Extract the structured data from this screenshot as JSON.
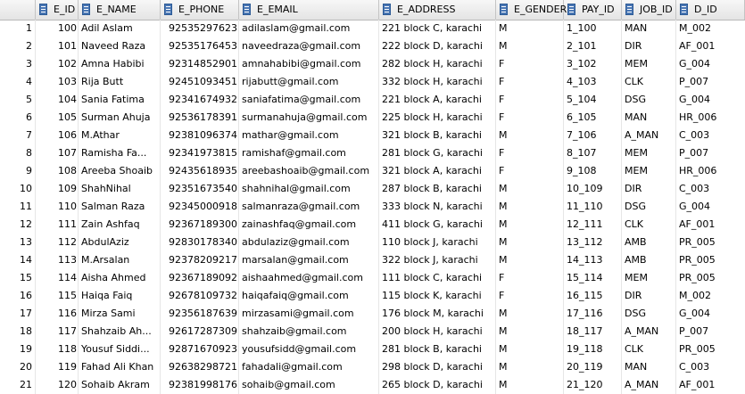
{
  "columns": [
    {
      "key": "rownum",
      "label": ""
    },
    {
      "key": "e_id",
      "label": "E_ID"
    },
    {
      "key": "e_name",
      "label": "E_NAME"
    },
    {
      "key": "e_phone",
      "label": "E_PHONE"
    },
    {
      "key": "e_email",
      "label": "E_EMAIL"
    },
    {
      "key": "e_address",
      "label": "E_ADDRESS"
    },
    {
      "key": "e_gender",
      "label": "E_GENDER"
    },
    {
      "key": "pay_id",
      "label": "PAY_ID"
    },
    {
      "key": "job_id",
      "label": "JOB_ID"
    },
    {
      "key": "d_id",
      "label": "D_ID"
    }
  ],
  "rows": [
    [
      "1",
      "100",
      "Adil Aslam",
      "92535297623",
      "adilaslam@gmail.com",
      "221 block C, karachi",
      "M",
      "1_100",
      "MAN",
      "M_002"
    ],
    [
      "2",
      "101",
      "Naveed Raza",
      "92535176453",
      "naveedraza@gmail.com",
      "222 block D, karachi",
      "M",
      "2_101",
      "DIR",
      "AF_001"
    ],
    [
      "3",
      "102",
      "Amna Habibi",
      "92314852901",
      "amnahabibi@gmail.com",
      "282 block H, karachi",
      "F",
      "3_102",
      "MEM",
      "G_004"
    ],
    [
      "4",
      "103",
      "Rija Butt",
      "92451093451",
      "rijabutt@gmail.com",
      "332 block H, karachi",
      "F",
      "4_103",
      "CLK",
      "P_007"
    ],
    [
      "5",
      "104",
      "Sania Fatima",
      "92341674932",
      "saniafatima@gmail.com",
      "221 block A, karachi",
      "F",
      "5_104",
      "DSG",
      "G_004"
    ],
    [
      "6",
      "105",
      "Surman Ahuja",
      "92536178391",
      "surmanahuja@gmail.com",
      "225 block H, karachi",
      "F",
      "6_105",
      "MAN",
      "HR_006"
    ],
    [
      "7",
      "106",
      "M.Athar",
      "92381096374",
      "mathar@gmail.com",
      "321 block B, karachi",
      "M",
      "7_106",
      "A_MAN",
      "C_003"
    ],
    [
      "8",
      "107",
      "Ramisha Fa...",
      "92341973815",
      "ramishaf@gmail.com",
      "281 block G, karachi",
      "F",
      "8_107",
      "MEM",
      "P_007"
    ],
    [
      "9",
      "108",
      "Areeba Shoaib",
      "92435618935",
      "areebashoaib@gmail.com",
      "321 block A, karachi",
      "F",
      "9_108",
      "MEM",
      "HR_006"
    ],
    [
      "10",
      "109",
      "ShahNihal",
      "92351673540",
      "shahnihal@gmail.com",
      "287 block B, karachi",
      "M",
      "10_109",
      "DIR",
      "C_003"
    ],
    [
      "11",
      "110",
      "Salman Raza",
      "92345000918",
      "salmanraza@gmail.com",
      "333 block N, karachi",
      "M",
      "11_110",
      "DSG",
      "G_004"
    ],
    [
      "12",
      "111",
      "Zain Ashfaq",
      "92367189300",
      "zainashfaq@gmail.com",
      "411 block G, karachi",
      "M",
      "12_111",
      "CLK",
      "AF_001"
    ],
    [
      "13",
      "112",
      "AbdulAziz",
      "92830178340",
      "abdulaziz@gmail.com",
      "110 block J, karachi",
      "M",
      "13_112",
      "AMB",
      "PR_005"
    ],
    [
      "14",
      "113",
      "M.Arsalan",
      "92378209217",
      "marsalan@gmail.com",
      "322 block J, karachi",
      "M",
      "14_113",
      "AMB",
      "PR_005"
    ],
    [
      "15",
      "114",
      "Aisha Ahmed",
      "92367189092",
      "aishaahmed@gmail.com",
      "111 block C, karachi",
      "F",
      "15_114",
      "MEM",
      "PR_005"
    ],
    [
      "16",
      "115",
      "Haiqa Faiq",
      "92678109732",
      "haiqafaiq@gmail.com",
      "115 block K, karachi",
      "F",
      "16_115",
      "DIR",
      "M_002"
    ],
    [
      "17",
      "116",
      "Mirza Sami",
      "92356187639",
      "mirzasami@gmail.com",
      "176 block M, karachi",
      "M",
      "17_116",
      "DSG",
      "G_004"
    ],
    [
      "18",
      "117",
      "Shahzaib Ah...",
      "92617287309",
      "shahzaib@gmail.com",
      "200 block H, karachi",
      "M",
      "18_117",
      "A_MAN",
      "P_007"
    ],
    [
      "19",
      "118",
      "Yousuf Siddi...",
      "92871670923",
      "yousufsidd@gmail.com",
      "281 block B, karachi",
      "M",
      "19_118",
      "CLK",
      "PR_005"
    ],
    [
      "20",
      "119",
      "Fahad Ali Khan",
      "92638298721",
      "fahadali@gmail.com",
      "298 block D, karachi",
      "M",
      "20_119",
      "MAN",
      "C_003"
    ],
    [
      "21",
      "120",
      "Sohaib Akram",
      "92381998176",
      "sohaib@gmail.com",
      "265 block D, karachi",
      "M",
      "21_120",
      "A_MAN",
      "AF_001"
    ]
  ]
}
